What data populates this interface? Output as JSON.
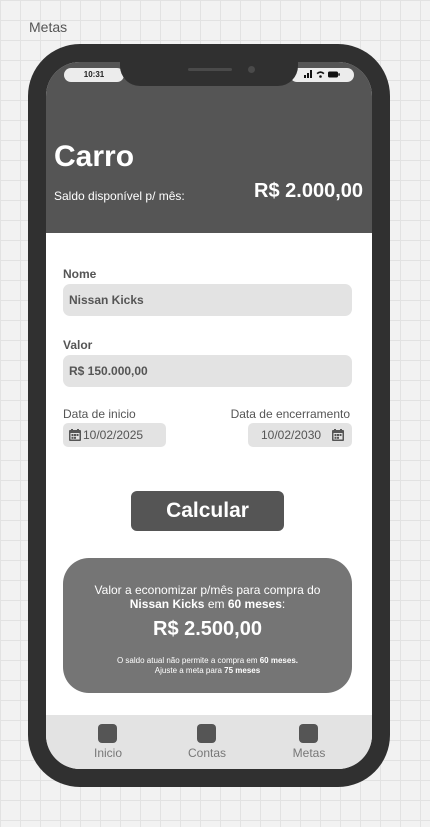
{
  "frame": {
    "label": "Metas"
  },
  "status_bar": {
    "time": "10:31",
    "icons": "signal wifi battery"
  },
  "header": {
    "goal_title": "Carro",
    "balance_label": "Saldo disponível p/ mês:",
    "balance_value": "R$ 2.000,00"
  },
  "form": {
    "name_label": "Nome",
    "name_value": "Nissan Kicks",
    "value_label": "Valor",
    "value_value": "R$ 150.000,00",
    "start_date_label": "Data de inicio",
    "start_date_value": "10/02/2025",
    "end_date_label": "Data de encerramento",
    "end_date_value": "10/02/2030",
    "calculate_label": "Calcular"
  },
  "result": {
    "line1": "Valor a economizar p/mês para compra do",
    "item_name": "Nissan Kicks",
    "in_text": "em",
    "months_text": "60 meses",
    "colon": ":",
    "amount": "R$ 2.500,00",
    "note_prefix": "O saldo atual não permite a compra em",
    "note_bold": "60 meses.",
    "note2_prefix": "Ajuste a meta para",
    "note2_bold": "75 meses"
  },
  "nav": {
    "items": [
      {
        "label": "Inicio",
        "icon": "home-icon"
      },
      {
        "label": "Contas",
        "icon": "accounts-icon"
      },
      {
        "label": "Metas",
        "icon": "goals-icon"
      }
    ]
  },
  "colors": {
    "header_bg": "#555555",
    "card_bg": "#757575",
    "field_bg": "#e3e3e3",
    "phone_frame": "#303030"
  }
}
